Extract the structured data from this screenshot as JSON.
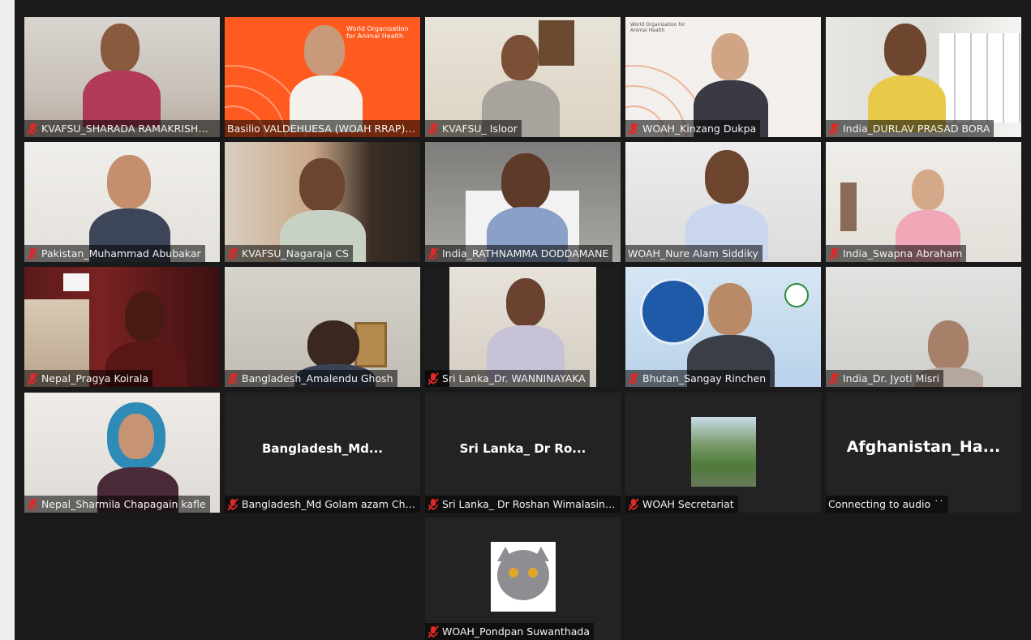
{
  "participants": [
    {
      "name": "KVAFSU_SHARADA RAMAKRISHNAI...",
      "muted": true
    },
    {
      "name": "Basilio VALDEHUESA (WOAH RRAP) (H...",
      "muted": false
    },
    {
      "name": "KVAFSU_ Isloor",
      "muted": true
    },
    {
      "name": "WOAH_Kinzang Dukpa",
      "muted": true
    },
    {
      "name": "India_DURLAV PRASAD BORA",
      "muted": true
    },
    {
      "name": "Pakistan_Muhammad Abubakar",
      "muted": true
    },
    {
      "name": "KVAFSU_Nagaraja CS",
      "muted": true
    },
    {
      "name": "India_RATHNAMMA DODDAMANE",
      "muted": true
    },
    {
      "name": "WOAH_Nure Alam Siddiky",
      "muted": false
    },
    {
      "name": "India_Swapna Abraham",
      "muted": true
    },
    {
      "name": "Nepal_Pragya Koirala",
      "muted": true
    },
    {
      "name": "Bangladesh_Amalendu Ghosh",
      "muted": true
    },
    {
      "name": "Sri Lanka_Dr. WANNINAYAKA",
      "muted": true
    },
    {
      "name": "Bhutan_Sangay Rinchen",
      "muted": true
    },
    {
      "name": "India_Dr. Jyoti Misri",
      "muted": true
    },
    {
      "name": "Nepal_Sharmila Chapagain kafle",
      "muted": true
    },
    {
      "name": "Bangladesh_Md Golam azam Chow...",
      "muted": true,
      "display_name": "Bangladesh_Md..."
    },
    {
      "name": "Sri Lanka_ Dr Roshan Wimalasinghe",
      "muted": true,
      "display_name": "Sri Lanka_ Dr Ro..."
    },
    {
      "name": "WOAH Secretariat",
      "muted": true
    },
    {
      "name": "Connecting to audio ˙˙",
      "muted": false,
      "display_name": "Afghanistan_Ha..."
    },
    {
      "name": "WOAH_Pondpan Suwanthada",
      "muted": true
    }
  ],
  "colors": {
    "grid_background": "#1a1a1a",
    "tile_background": "#232323",
    "muted_icon": "#e02828",
    "woah_orange": "#ff5a1f"
  },
  "logos": {
    "woah_tile_logo": "World Organisation for Animal Health",
    "woah_tile_logo_2": "World Organisation for Animal Health"
  }
}
